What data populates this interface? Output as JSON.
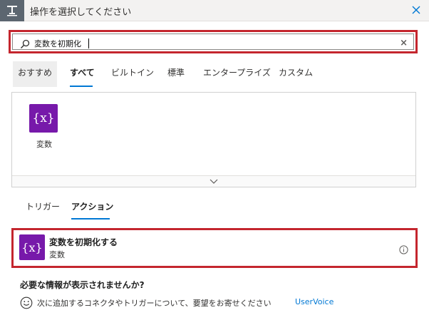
{
  "header": {
    "title": "操作を選択してください",
    "icon": "trigger-step-icon",
    "close_icon": "close-icon",
    "accent": "#5c6670"
  },
  "search": {
    "value": "変数を初期化",
    "icon": "search-icon",
    "clear_label": "×"
  },
  "tabs": [
    {
      "label": "おすすめ"
    },
    {
      "label": "すべて",
      "selected": true
    },
    {
      "label": "ビルトイン"
    },
    {
      "label": "標準"
    },
    {
      "label": "エンタープライズ"
    },
    {
      "label": "カスタム"
    }
  ],
  "connectors": [
    {
      "label": "変数",
      "icon_text": "{x}",
      "color": "#7719aa"
    }
  ],
  "sub_tabs": [
    {
      "label": "トリガー"
    },
    {
      "label": "アクション",
      "selected": true
    }
  ],
  "action": {
    "title": "変数を初期化する",
    "subtitle": "変数",
    "icon_text": "{x}",
    "info_icon": "info-icon"
  },
  "help": {
    "heading": "必要な情報が表示されませんか?",
    "text": "次に追加するコネクタやトリガーについて、要望をお寄せください",
    "link": "UserVoice",
    "icon": "smiley-icon"
  },
  "colors": {
    "highlight_border": "#c4262e",
    "selected_underline": "#0078d4",
    "variable_purple": "#7719aa",
    "link": "#0078d4"
  }
}
